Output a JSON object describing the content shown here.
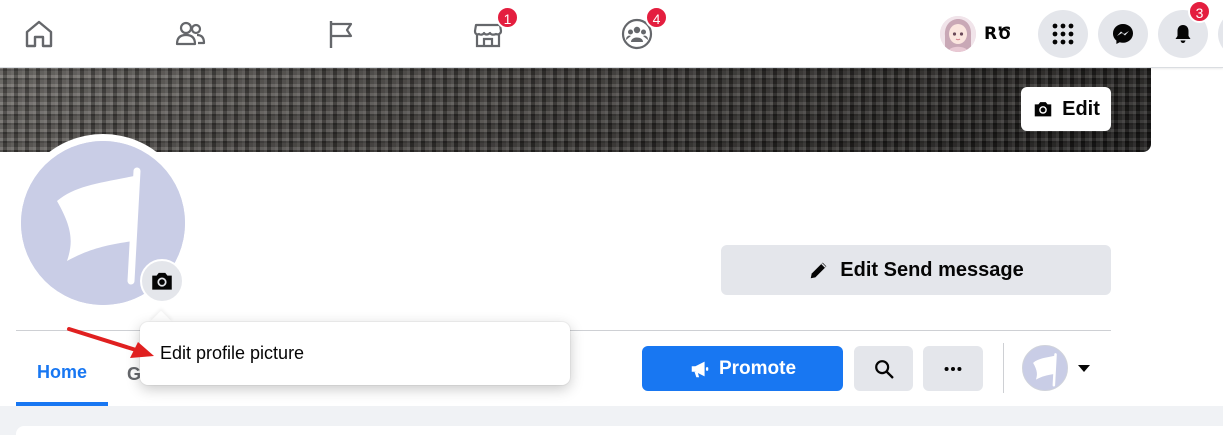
{
  "topnav": {
    "items": [
      {
        "name": "home",
        "icon": "home-icon"
      },
      {
        "name": "friends",
        "icon": "friends-icon"
      },
      {
        "name": "pages",
        "icon": "flag-icon"
      },
      {
        "name": "marketplace",
        "icon": "marketplace-icon",
        "badge": "1"
      },
      {
        "name": "groups",
        "icon": "groups-icon",
        "badge": "4"
      }
    ],
    "profile_name": "RԾ",
    "menu_icon": "grid-menu-icon",
    "messenger_icon": "messenger-icon",
    "notifications_icon": "bell-icon",
    "notifications_badge": "3"
  },
  "cover": {
    "edit_label": "Edit"
  },
  "profile": {
    "edit_send_label": "Edit Send message"
  },
  "tabs": {
    "home": "Home",
    "partial": "G"
  },
  "actions": {
    "promote_label": "Promote"
  },
  "menu": {
    "edit_profile_picture": "Edit profile picture"
  },
  "colors": {
    "accent": "#1877f2",
    "badge": "#e41e3f",
    "arrow": "#e02020",
    "button_gray": "#e4e6eb",
    "placeholder": "#c9cde6"
  }
}
